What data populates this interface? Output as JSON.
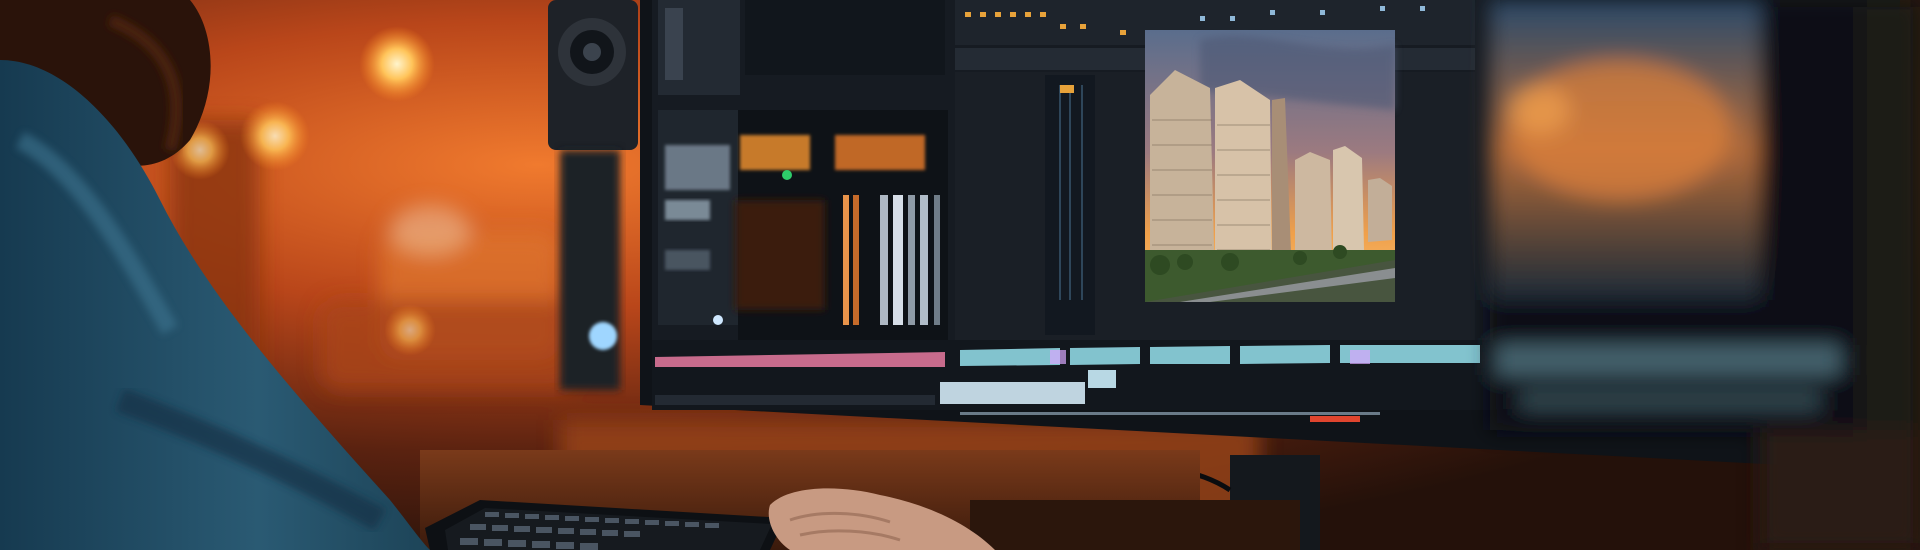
{
  "scene": {
    "subject": "video-editor-at-workstation",
    "palette": {
      "ambient_orange": "#c8541c",
      "deep_orange": "#6a2a10",
      "bezel_black": "#0f1318",
      "ui_dark": "#1b2129",
      "shirt_blue": "#1f4a63",
      "waveform_pink": "#e77aa0",
      "waveform_cyan": "#8fd6e2",
      "sky_orange": "#f0a04a"
    },
    "icons": [
      "desk-lamp-bokeh",
      "studio-speaker",
      "keyboard",
      "monitor",
      "hand"
    ]
  }
}
